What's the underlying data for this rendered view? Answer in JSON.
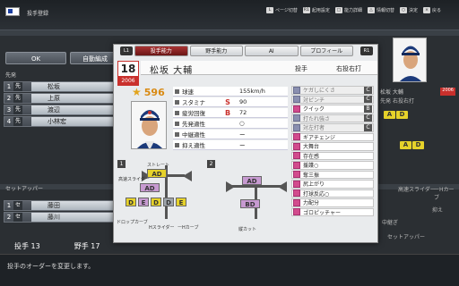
{
  "header": {
    "screen_title": "投手登録",
    "hints": [
      {
        "key": "L",
        "label": "ページ切替"
      },
      {
        "key": "R1",
        "label": "起用設定"
      },
      {
        "key": "□",
        "label": "能力詳細"
      },
      {
        "key": "△",
        "label": "情報切替"
      },
      {
        "key": "○",
        "label": "決定"
      },
      {
        "key": "×",
        "label": "戻る"
      }
    ]
  },
  "buttons": {
    "ok": "OK",
    "auto": "自動編成"
  },
  "roster": {
    "starters_label": "先発",
    "starters": [
      {
        "no": "1",
        "pos": "先",
        "name": "松坂"
      },
      {
        "no": "2",
        "pos": "先",
        "name": "上原"
      },
      {
        "no": "3",
        "pos": "先",
        "name": "渡辺"
      },
      {
        "no": "4",
        "pos": "先",
        "name": "小林宏"
      }
    ],
    "setup_label": "セットアッパー",
    "setup": [
      {
        "no": "1",
        "pos": "セ",
        "name": "藤田"
      },
      {
        "no": "2",
        "pos": "セ",
        "name": "藤川"
      }
    ],
    "pitcher_count": "投手 13",
    "fielder_count": "野手 17"
  },
  "tabs": [
    "投手能力",
    "野手能力",
    "AI",
    "プロフィール"
  ],
  "tab_keys": {
    "left": "L1",
    "right": "R1"
  },
  "player": {
    "number": "18",
    "year": "2006",
    "name": "松坂 大輔",
    "position": "投手",
    "handedness": "右投右打",
    "overall": "596"
  },
  "stats": [
    {
      "label": "球速",
      "grade": "",
      "value": "155km/h",
      "color": "#222222"
    },
    {
      "label": "スタミナ",
      "grade": "S",
      "value": "90",
      "color": "#c9302c"
    },
    {
      "label": "疲労回復",
      "grade": "B",
      "value": "72",
      "color": "#c9302c"
    },
    {
      "label": "先発適性",
      "grade": "",
      "value": "○",
      "color": "#222222"
    },
    {
      "label": "中継適性",
      "grade": "",
      "value": "ー",
      "color": "#222222"
    },
    {
      "label": "抑え適性",
      "grade": "",
      "value": "ー",
      "color": "#222222"
    }
  ],
  "abilities": [
    {
      "name": "ケガしにくさ",
      "grade": "C",
      "kind": "neg"
    },
    {
      "name": "対ピンチ",
      "grade": "C",
      "kind": "neg"
    },
    {
      "name": "クイック",
      "grade": "B",
      "kind": "pos"
    },
    {
      "name": "打たれ強さ",
      "grade": "C",
      "kind": "neg"
    },
    {
      "name": "対左打者",
      "grade": "C",
      "kind": "neg"
    },
    {
      "name": "ギアチェンジ",
      "grade": "",
      "kind": "pos"
    },
    {
      "name": "大舞台",
      "grade": "",
      "kind": "pos"
    },
    {
      "name": "存在感",
      "grade": "",
      "kind": "pos"
    },
    {
      "name": "援護○",
      "grade": "",
      "kind": "pos"
    },
    {
      "name": "奪三振",
      "grade": "",
      "kind": "pos"
    },
    {
      "name": "尻上がり",
      "grade": "",
      "kind": "pos"
    },
    {
      "name": "打球反応○",
      "grade": "",
      "kind": "pos"
    },
    {
      "name": "力配分",
      "grade": "",
      "kind": "pos"
    },
    {
      "name": "ゴロピッチャー",
      "grade": "",
      "kind": "pos"
    }
  ],
  "pitches": {
    "box1": "1",
    "box2": "2",
    "straight": "ストレート",
    "fast_slider": "高速スライダー",
    "drop_curve": "ドロップカーブ",
    "h_slider": "Hスライダー",
    "h_curve": "ーHカーブ",
    "cut": "縦カット",
    "grades": {
      "straight": "AD",
      "fast_slider": "AD",
      "row1": "D",
      "row2": "E",
      "row3": "D",
      "row4": "D",
      "row5": "E",
      "cut_top": "AD",
      "cut_bottom": "BD"
    }
  },
  "right_panel": {
    "name": "松坂 大輔",
    "year": "2006",
    "position": "先発",
    "handedness": "右投右打",
    "grade1": "A",
    "grade2": "D",
    "grade3": "A",
    "grade4": "D",
    "line_fast_slider": "高速スライダー",
    "line_curve": "ーHカーブ",
    "suppress": "抑え",
    "relief": "中継ぎ",
    "setup": "セットアッパー"
  },
  "status": {
    "message": "投手のオーダーを変更します。"
  }
}
